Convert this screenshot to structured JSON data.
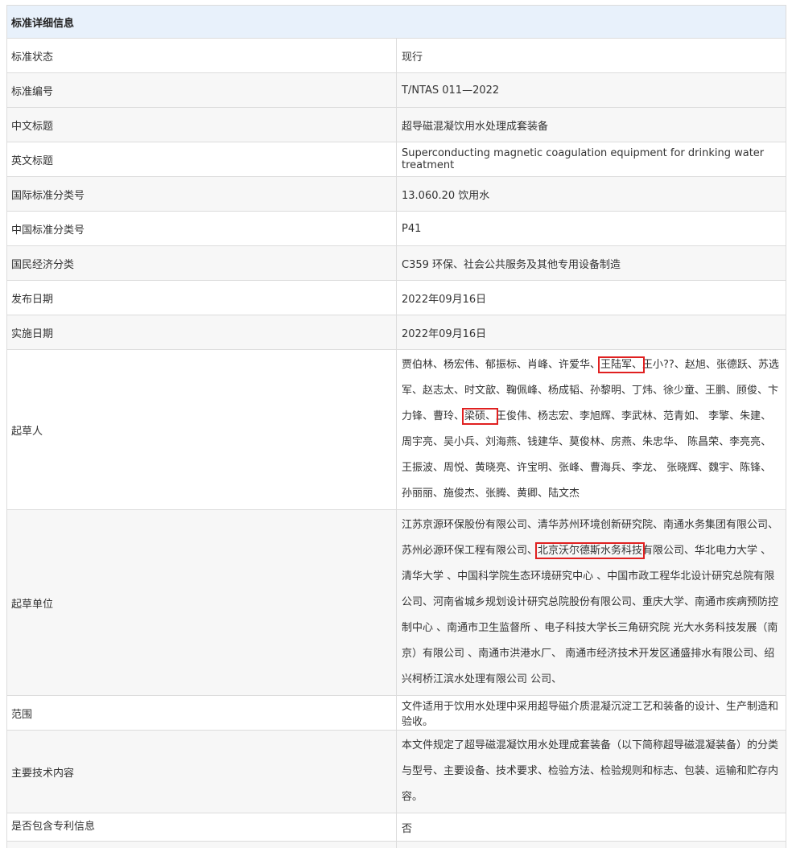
{
  "header": "标准详细信息",
  "rows": {
    "status": {
      "label": "标准状态",
      "value": "现行"
    },
    "number": {
      "label": "标准编号",
      "value": "T/NTAS 011—2022"
    },
    "cn_title": {
      "label": "中文标题",
      "value": "超导磁混凝饮用水处理成套装备"
    },
    "en_title": {
      "label": "英文标题",
      "value": "Superconducting magnetic coagulation equipment for drinking water treatment"
    },
    "ics": {
      "label": "国际标准分类号",
      "value": "13.060.20 饮用水"
    },
    "ccs": {
      "label": "中国标准分类号",
      "value": "P41"
    },
    "economy": {
      "label": "国民经济分类",
      "value": "C359 环保、社会公共服务及其他专用设备制造"
    },
    "publish": {
      "label": "发布日期",
      "value": "2022年09月16日"
    },
    "implement": {
      "label": "实施日期",
      "value": "2022年09月16日"
    },
    "drafters": {
      "label": "起草人",
      "seg1": "贾伯林、杨宏伟、郁振标、肖峰、许爱华、",
      "hl1": "王陆军、",
      "seg2": "王小??、赵旭、张德跃、苏选军、赵志太、时文歆、鞠佩峰、杨成韬、孙黎明、丁炜、徐少童、王鹏、顾俊、卞力锋、曹玲、",
      "hl2": "梁硕、",
      "seg3": "王俊伟、杨志宏、李旭辉、李武林、范青如、 李擎、朱建、周宇亮、吴小兵、刘海燕、钱建华、莫俊林、房燕、朱忠华、 陈昌荣、李亮亮、王振波、周悦、黄晓亮、许宝明、张峰、曹海兵、李龙、 张晓辉、魏宇、陈锋、孙丽丽、施俊杰、张腾、黄卿、陆文杰"
    },
    "units": {
      "label": "起草单位",
      "seg1": "江苏京源环保股份有限公司、清华苏州环境创新研究院、南通水务集团有限公司、苏州必源环保工程有限公司、",
      "hl1": "北京沃尔德斯水务科技",
      "seg2": "有限公司、华北电力大学 、清华大学 、中国科学院生态环境研究中心 、中国市政工程华北设计研究总院有限公司、河南省城乡规划设计研究总院股份有限公司、重庆大学、南通市疾病预防控制中心 、南通市卫生监督所 、电子科技大学长三角研究院 光大水务科技发展（南京）有限公司 、南通市洪港水厂、 南通市经济技术开发区通盛排水有限公司、绍兴柯桥江滨水处理有限公司 公司、"
    },
    "scope": {
      "label": "范围",
      "value": "文件适用于饮用水处理中采用超导磁介质混凝沉淀工艺和装备的设计、生产制造和验收。"
    },
    "tech": {
      "label": "主要技术内容",
      "value": "本文件规定了超导磁混凝饮用水处理成套装备（以下简称超导磁混凝装备）的分类与型号、主要设备、技术要求、检验方法、检验规则和标志、包装、运输和贮存内容。"
    },
    "patent": {
      "label": "是否包含专利信息",
      "value": "否"
    }
  }
}
